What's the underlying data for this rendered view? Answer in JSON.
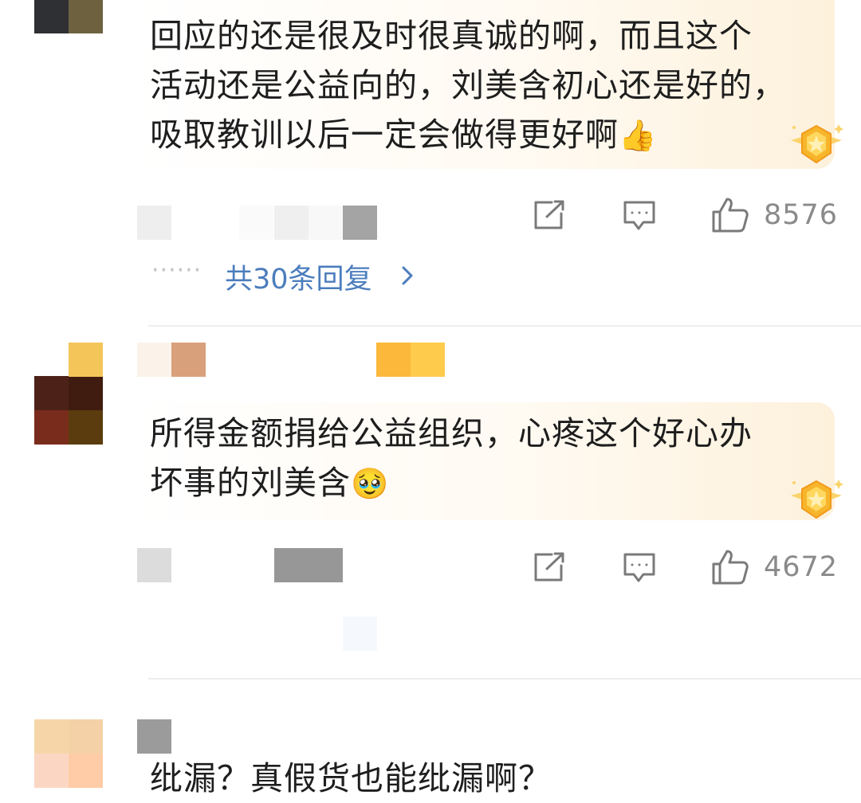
{
  "comments": [
    {
      "text_lines": [
        "回应的还是很及时很真诚的啊，而且这个",
        "活动还是公益向的，刘美含初心还是好的，",
        "吸取教训以后一定会做得更好啊"
      ],
      "emoji": "👍",
      "like_count": "8576",
      "reply_summary": "共30条回复",
      "reply_dots": "······"
    },
    {
      "text_lines": [
        "所得金额捐给公益组织，心疼这个好心办",
        "坏事的刘美含"
      ],
      "emoji": "🥹",
      "like_count": "4672"
    },
    {
      "text_lines": [
        "纰漏？真假货也能纰漏啊？"
      ]
    }
  ],
  "icons": {
    "share": "share-icon",
    "comment": "comment-icon",
    "like": "thumbs-up-icon",
    "badge": "gold-star-badge-icon",
    "chevron": "chevron-right-icon"
  },
  "colors": {
    "link": "#4c7dbd",
    "count": "#8a8a8a",
    "badge_gold": "#f6b52b"
  }
}
